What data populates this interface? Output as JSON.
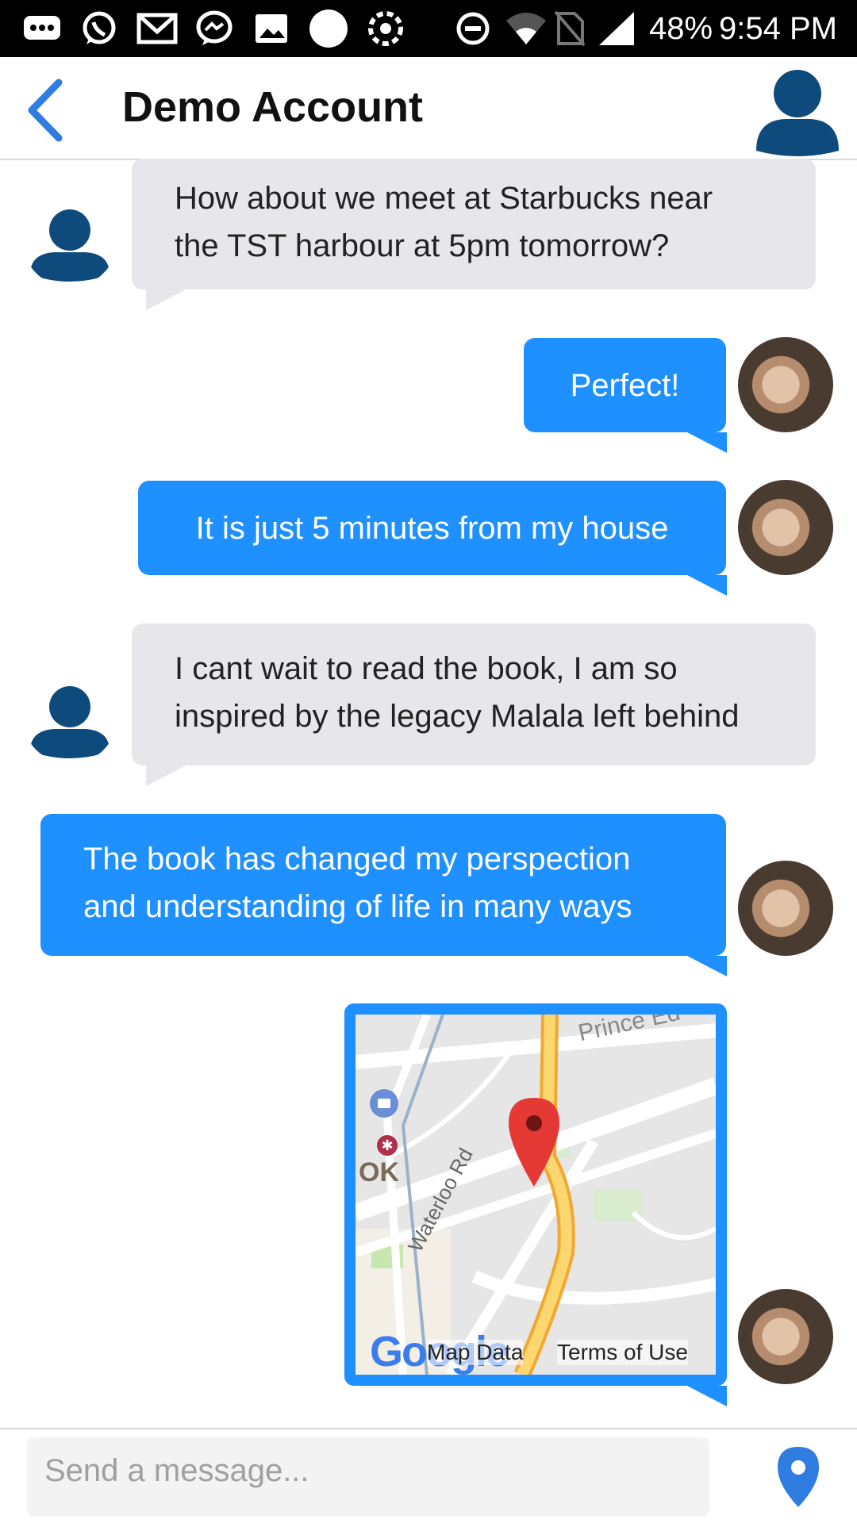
{
  "status_bar": {
    "icons": [
      "more-icon",
      "whatsapp-icon",
      "gmail-icon",
      "messenger-icon",
      "gallery-icon",
      "circle-icon",
      "sync-icon",
      "dnd-icon",
      "wifi-icon",
      "no-sim-icon",
      "signal-icon"
    ],
    "battery": "48%",
    "time": "9:54 PM"
  },
  "header": {
    "title": "Demo Account",
    "back_icon": "chevron-left-icon",
    "avatar_icon": "user-avatar-icon"
  },
  "messages": [
    {
      "direction": "incoming",
      "text": "How about we meet at Starbucks near\nthe TST harbour at 5pm tomorrow?"
    },
    {
      "direction": "outgoing",
      "text": "Perfect!"
    },
    {
      "direction": "outgoing",
      "text": "It is just 5 minutes from my house"
    },
    {
      "direction": "incoming",
      "text": "I cant wait to read the book, I am so\ninspired by the legacy Malala left behind"
    },
    {
      "direction": "outgoing",
      "text": "The book has changed my perspection\nand understanding of life in many ways"
    },
    {
      "direction": "outgoing",
      "type": "map",
      "labels": {
        "street_1": "Prince Ed",
        "street_2": "Waterloo Rd",
        "area": "OK"
      },
      "footer": {
        "logo": "Google",
        "map_data": "Map Data",
        "terms": "Terms of Use"
      }
    }
  ],
  "composer": {
    "placeholder": "Send a message...",
    "location_icon": "location-pin-icon"
  },
  "colors": {
    "accent": "#1e90ff",
    "incoming_bubble": "#e6e6eb",
    "avatar_default": "#0f4a7d",
    "back_chevron": "#2f7de1"
  }
}
